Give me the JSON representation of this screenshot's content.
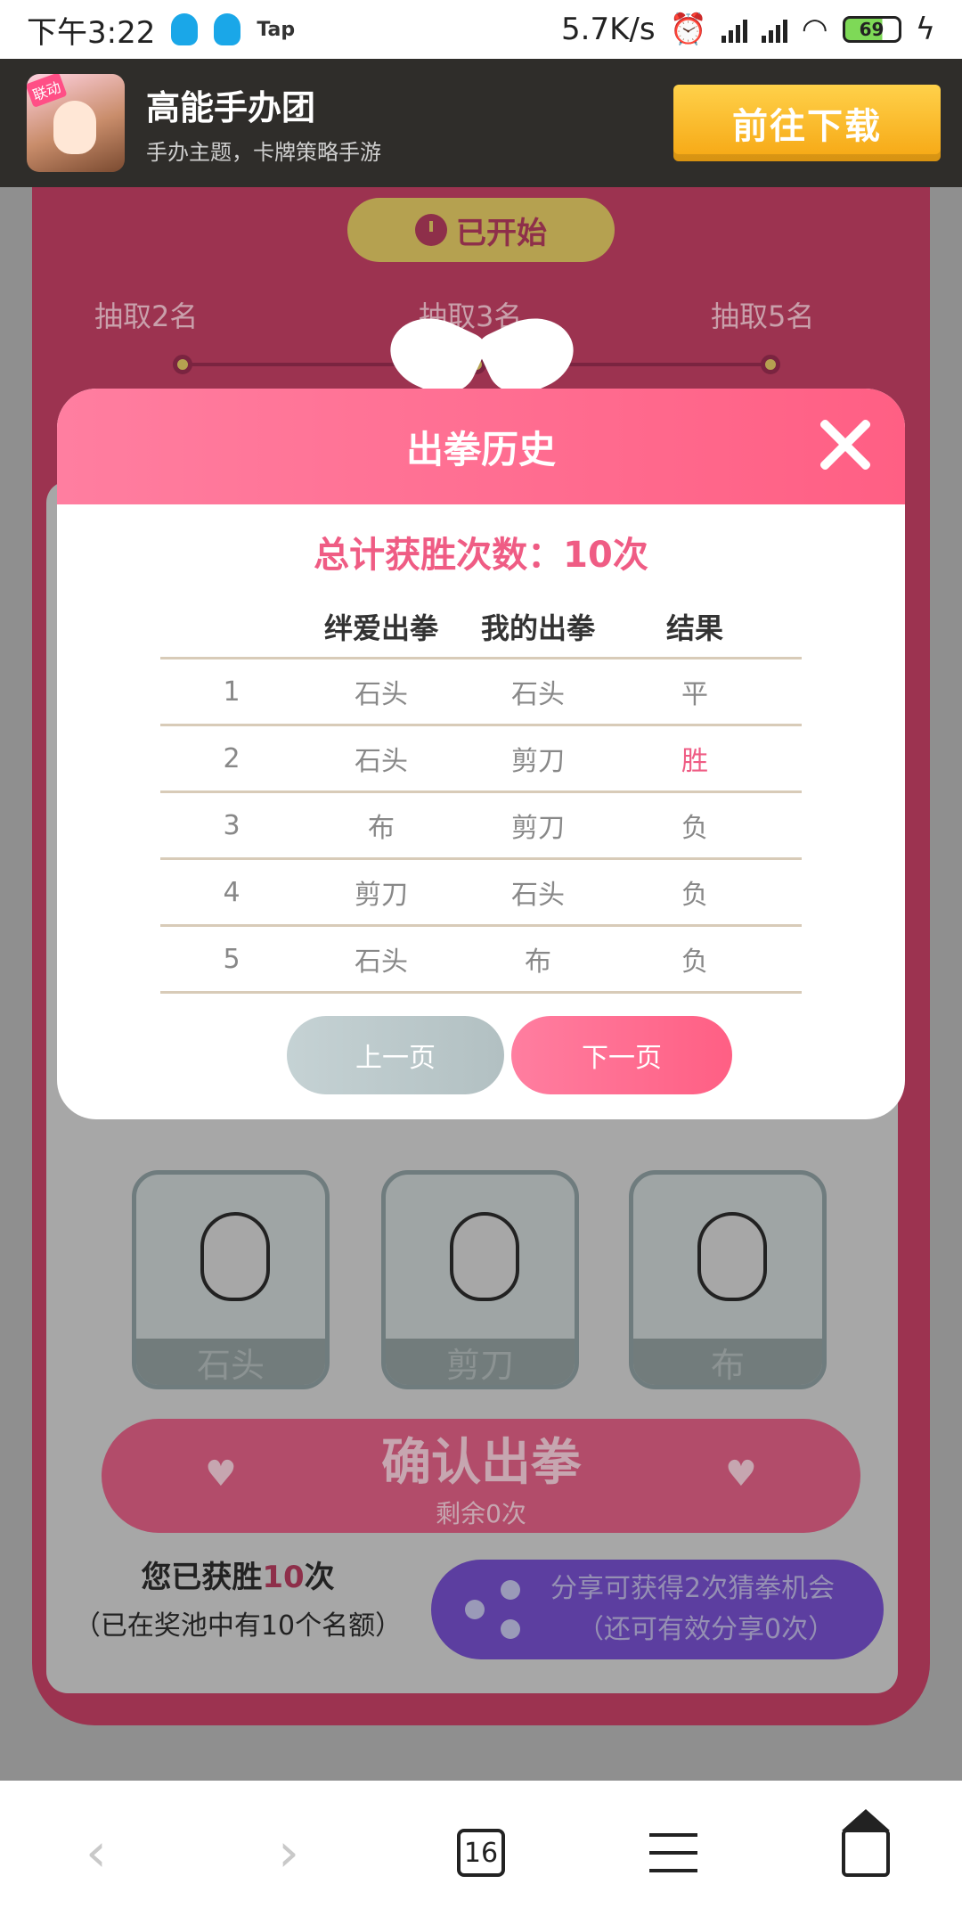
{
  "status_bar": {
    "time": "下午3:22",
    "app_label": "Tap",
    "net_speed": "5.7K/s",
    "battery": "69"
  },
  "ad_banner": {
    "badge": "联动",
    "title": "高能手办团",
    "subtitle": "手办主题，卡牌策略手游",
    "button_label": "前往下载"
  },
  "game": {
    "status_label": "已开始",
    "tiers": [
      "抽取2名",
      "抽取3名",
      "抽取5名"
    ],
    "choices": [
      "石头",
      "剪刀",
      "布"
    ],
    "confirm": {
      "label": "确认出拳",
      "remaining": "剩余0次"
    },
    "wins_line_prefix": "您已获胜",
    "wins_count": "10",
    "wins_line_suffix": "次",
    "pool_note": "（已在奖池中有10个名额）",
    "share": {
      "line1": "分享可获得2次猜拳机会",
      "line2": "（还可有效分享0次）"
    }
  },
  "modal": {
    "title": "出拳历史",
    "total": "总计获胜次数：10次",
    "columns": [
      "",
      "绊爱出拳",
      "我的出拳",
      "结果"
    ],
    "rows": [
      [
        "1",
        "石头",
        "石头",
        "平"
      ],
      [
        "2",
        "石头",
        "剪刀",
        "胜"
      ],
      [
        "3",
        "布",
        "剪刀",
        "负"
      ],
      [
        "4",
        "剪刀",
        "石头",
        "负"
      ],
      [
        "5",
        "石头",
        "布",
        "负"
      ]
    ],
    "prev_label": "上一页",
    "next_label": "下一页"
  },
  "browser_nav": {
    "back_icon": "‹",
    "forward_icon": "›",
    "tab_count": "16"
  },
  "colors": {
    "accent_pink": "#ff5f84",
    "win_text": "#ef5c84",
    "download_yellow": "#f6a713"
  }
}
